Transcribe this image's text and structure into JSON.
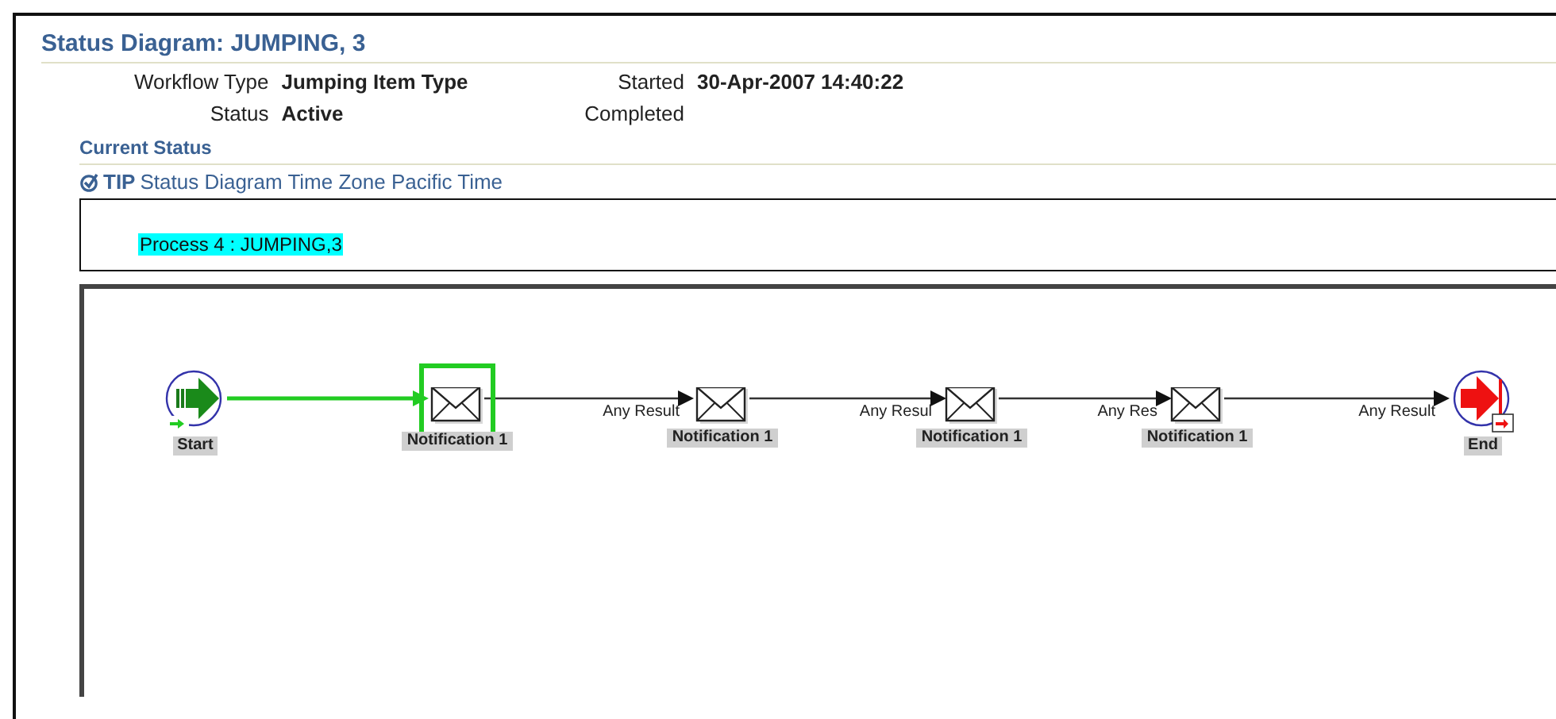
{
  "title": "Status Diagram: JUMPING, 3",
  "details": [
    {
      "label": "Workflow Type",
      "value": "Jumping Item Type"
    },
    {
      "label": "Status",
      "value": "Active"
    }
  ],
  "details_right": [
    {
      "label": "Started",
      "value": "30-Apr-2007 14:40:22"
    },
    {
      "label": "Completed"
    }
  ],
  "current_status": {
    "heading": "Current Status",
    "tip_label": "TIP",
    "tip_text": "Status Diagram Time Zone Pacific Time"
  },
  "process": {
    "label": "Process 4 : JUMPING,3",
    "selected": true
  },
  "diagram": {
    "nodes": [
      {
        "kind": "start",
        "label": "Start",
        "active": false
      },
      {
        "kind": "notification",
        "label": "Notification 1",
        "active": true
      },
      {
        "kind": "notification",
        "label": "Notification 1",
        "active": false
      },
      {
        "kind": "notification",
        "label": "Notification 1",
        "active": false
      },
      {
        "kind": "notification",
        "label": "Notification 1",
        "active": false
      },
      {
        "kind": "end",
        "label": "End",
        "active": false
      }
    ],
    "edges": [
      {
        "traversed": true
      },
      {
        "label": "Any Result",
        "traversed": false
      },
      {
        "label": "Any Resul",
        "traversed": false
      },
      {
        "label": "Any Res",
        "traversed": false
      },
      {
        "label": "Any Result",
        "traversed": false
      }
    ]
  }
}
